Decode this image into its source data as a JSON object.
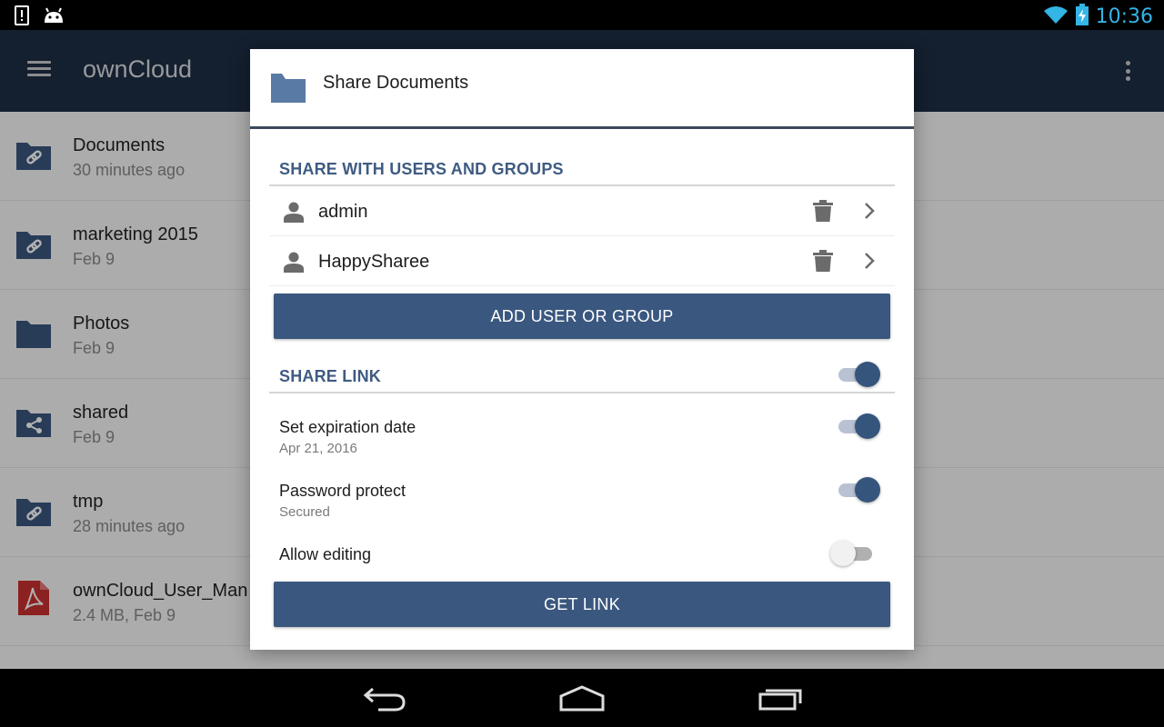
{
  "status_bar": {
    "time": "10:36",
    "icons": [
      "alert-icon",
      "android-icon",
      "wifi-icon",
      "battery-charging-icon"
    ]
  },
  "app_bar": {
    "title": "ownCloud",
    "menu_icon": "hamburger-menu-icon",
    "overflow_icon": "more-vertical-icon"
  },
  "files": [
    {
      "name": "Documents",
      "meta": "30 minutes ago",
      "icon": "folder-link-icon"
    },
    {
      "name": "marketing 2015",
      "meta": "Feb 9",
      "icon": "folder-link-icon"
    },
    {
      "name": "Photos",
      "meta": "Feb 9",
      "icon": "folder-icon"
    },
    {
      "name": "shared",
      "meta": "Feb 9",
      "icon": "folder-shared-icon"
    },
    {
      "name": "tmp",
      "meta": "28 minutes ago",
      "icon": "folder-link-icon"
    },
    {
      "name": "ownCloud_User_Man",
      "meta": "2.4 MB, Feb 9",
      "icon": "pdf-icon"
    }
  ],
  "dialog": {
    "title": "Share Documents",
    "share_users_heading": "SHARE WITH USERS AND GROUPS",
    "shares": [
      {
        "name": "admin"
      },
      {
        "name": "HappySharee"
      }
    ],
    "add_button": "ADD USER OR GROUP",
    "share_link_heading": "SHARE LINK",
    "share_link_enabled": true,
    "options": [
      {
        "label": "Set expiration date",
        "sub": "Apr 21, 2016",
        "enabled": true
      },
      {
        "label": "Password protect",
        "sub": "Secured",
        "enabled": true
      },
      {
        "label": "Allow editing",
        "sub": "",
        "enabled": false
      }
    ],
    "get_link_button": "GET LINK"
  },
  "nav_bar": {
    "icons": [
      "back-icon",
      "home-icon",
      "recents-icon"
    ]
  },
  "colors": {
    "app_bar": "#1d2d44",
    "accent": "#3a577f",
    "section_heading": "#3f5b82",
    "status_time": "#33b5e5"
  }
}
